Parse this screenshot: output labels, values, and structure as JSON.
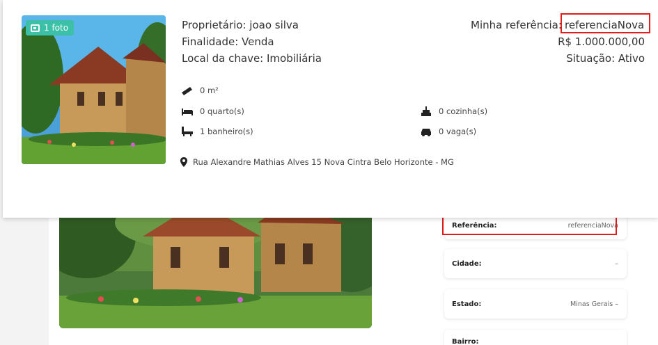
{
  "listing": {
    "photo_badge": "1 foto",
    "owner": "Proprietário: joao silva",
    "purpose": "Finalidade: Venda",
    "key_location": "Local da chave: Imobiliária",
    "my_reference_label": "Minha referência:",
    "my_reference_value": "referenciaNova",
    "price": "R$ 1.000.000,00",
    "status": "Situação: Ativo",
    "features": {
      "area": "0 m²",
      "bedrooms": "0 quarto(s)",
      "kitchens": "0 cozinha(s)",
      "bathrooms": "1 banheiro(s)",
      "parking": "0 vaga(s)"
    },
    "address": "Rua Alexandre Mathias Alves 15 Nova Cintra Belo Horizonte - MG"
  },
  "details": [
    {
      "label": "Referência:",
      "value": "referenciaNova"
    },
    {
      "label": "Cidade:",
      "value": "–"
    },
    {
      "label": "Estado:",
      "value": "Minas Gerais –"
    },
    {
      "label": "Bairro:",
      "value": ""
    }
  ],
  "icons": [
    "photo-icon",
    "ruler-icon",
    "bed-icon",
    "kitchen-icon",
    "bathtub-icon",
    "car-icon",
    "map-pin-icon"
  ],
  "colors": {
    "badge": "#3cc0a8",
    "highlight": "#e01e1e"
  }
}
